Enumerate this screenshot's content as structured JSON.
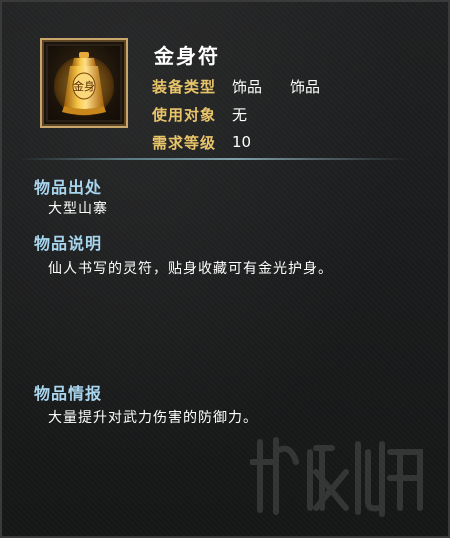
{
  "item": {
    "name": "金身符",
    "icon": "golden-talisman-icon",
    "icon_glyph": "金身"
  },
  "attributes": [
    {
      "label": "装备类型",
      "value": "饰品",
      "value2": "饰品"
    },
    {
      "label": "使用对象",
      "value": "无"
    },
    {
      "label": "需求等级",
      "value": "10"
    }
  ],
  "sections": {
    "source": {
      "title": "物品出处",
      "text": "大型山寨"
    },
    "description": {
      "title": "物品说明",
      "text": "仙人书写的灵符，贴身收藏可有金光护身。"
    },
    "info": {
      "title": "物品情报",
      "text": "大量提升对武力伤害的防御力。"
    }
  },
  "colors": {
    "label": "#e9c56a",
    "section_title": "#a9d6ef",
    "value": "#ffffff",
    "frame": "#c9a66b"
  }
}
